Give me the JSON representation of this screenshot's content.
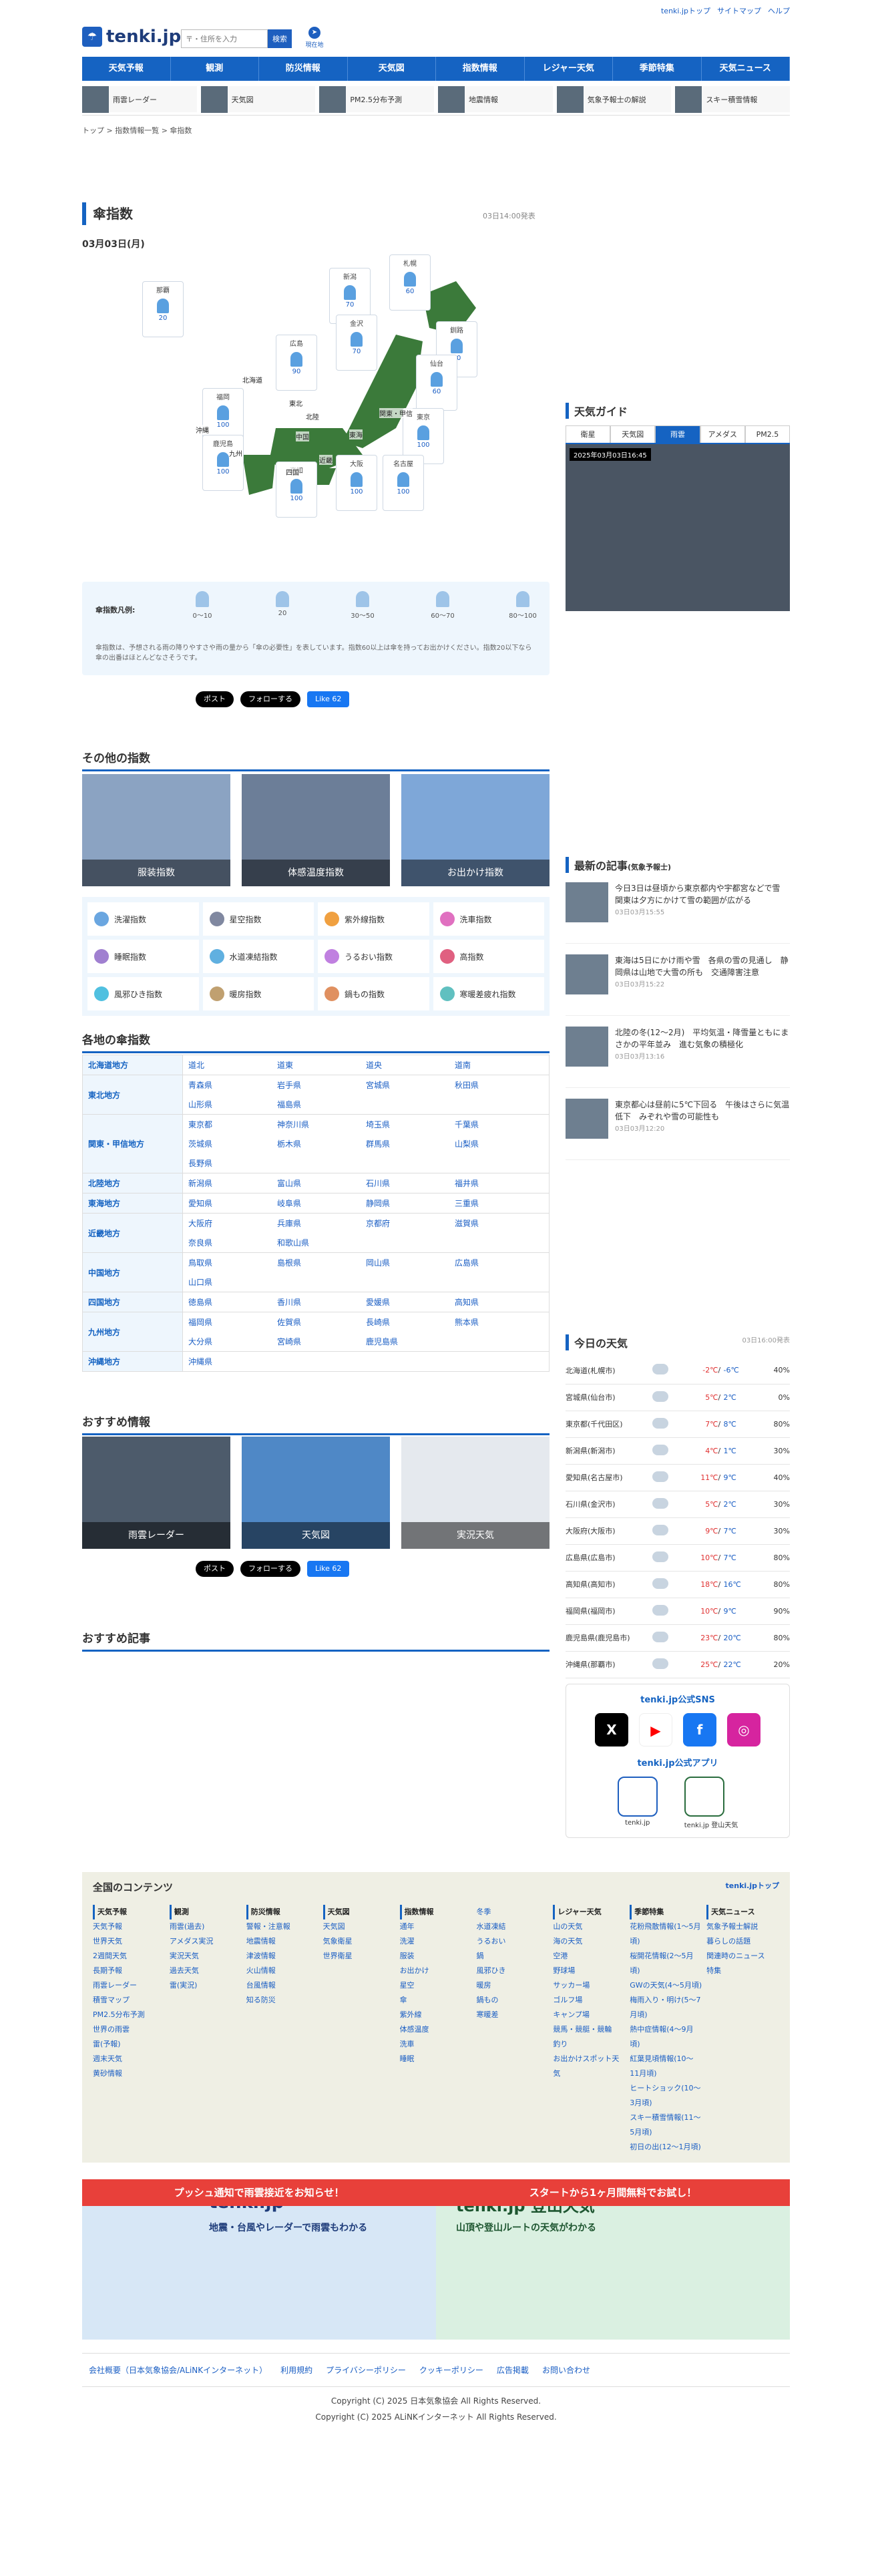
{
  "header": {
    "logo": "tenki.jp",
    "search_placeholder": "〒・住所を入力",
    "search_button": "検索",
    "geo": "現在地",
    "links": [
      "tenki.jpトップ",
      "サイトマップ",
      "ヘルプ"
    ]
  },
  "gnav": [
    "天気予報",
    "観測",
    "防災情報",
    "天気図",
    "指数情報",
    "レジャー天気",
    "季節特集",
    "天気ニュース"
  ],
  "subnav": [
    "雨雲レーダー",
    "天気図",
    "PM2.5分布予測",
    "地震情報",
    "気象予報士の解説",
    "スキー積雪情報"
  ],
  "breadcrumb": "トップ > 指数情報一覧 > 傘指数",
  "page": {
    "title": "傘指数",
    "issued": "03日14:00発表",
    "date": "03月03日(月)"
  },
  "cities": [
    {
      "name": "那覇",
      "val": "20"
    },
    {
      "name": "札幌",
      "val": "60"
    },
    {
      "name": "新潟",
      "val": "70"
    },
    {
      "name": "釧路",
      "val": "20"
    },
    {
      "name": "広島",
      "val": "90"
    },
    {
      "name": "金沢",
      "val": "70"
    },
    {
      "name": "仙台",
      "val": "60"
    },
    {
      "name": "福岡",
      "val": "100"
    },
    {
      "name": "鹿児島",
      "val": "100"
    },
    {
      "name": "東京",
      "val": "100"
    },
    {
      "name": "高知",
      "val": "100"
    },
    {
      "name": "大阪",
      "val": "100"
    },
    {
      "name": "名古屋",
      "val": "100"
    }
  ],
  "map_labels": [
    "沖縄",
    "北海道",
    "東北",
    "北陸",
    "中国",
    "近畿",
    "関東・甲信",
    "九州",
    "四国",
    "東海"
  ],
  "legend": {
    "title": "傘指数凡例:",
    "items": [
      "0〜10",
      "20",
      "30〜50",
      "60〜70",
      "80〜100"
    ],
    "note": "傘指数は、予想される雨の降りやすさや雨の量から「傘の必要性」を表しています。指数60以上は傘を持ってお出かけください。指数20以下なら傘の出番はほとんどなさそうです。"
  },
  "share": {
    "post": "ポスト",
    "follow": "フォローする",
    "like": "Like 62"
  },
  "other": {
    "title": "その他の指数",
    "tiles": [
      "服装指数",
      "体感温度指数",
      "お出かけ指数"
    ],
    "items": [
      "洗濯指数",
      "星空指数",
      "紫外線指数",
      "洗車指数",
      "睡眠指数",
      "水道凍結指数",
      "うるおい指数",
      "高指数",
      "風邪ひき指数",
      "暖房指数",
      "鍋もの指数",
      "寒暖差疲れ指数"
    ]
  },
  "regions": {
    "title": "各地の傘指数",
    "rows": [
      {
        "r": "北海道地方",
        "p": [
          "道北",
          "道東",
          "道央",
          "道南"
        ]
      },
      {
        "r": "東北地方",
        "p": [
          "青森県",
          "岩手県",
          "宮城県",
          "秋田県",
          "山形県",
          "福島県"
        ]
      },
      {
        "r": "関東・甲信地方",
        "p": [
          "東京都",
          "神奈川県",
          "埼玉県",
          "千葉県",
          "茨城県",
          "栃木県",
          "群馬県",
          "山梨県",
          "長野県"
        ]
      },
      {
        "r": "北陸地方",
        "p": [
          "新潟県",
          "富山県",
          "石川県",
          "福井県"
        ]
      },
      {
        "r": "東海地方",
        "p": [
          "愛知県",
          "岐阜県",
          "静岡県",
          "三重県"
        ]
      },
      {
        "r": "近畿地方",
        "p": [
          "大阪府",
          "兵庫県",
          "京都府",
          "滋賀県",
          "奈良県",
          "和歌山県"
        ]
      },
      {
        "r": "中国地方",
        "p": [
          "鳥取県",
          "島根県",
          "岡山県",
          "広島県",
          "山口県"
        ]
      },
      {
        "r": "四国地方",
        "p": [
          "徳島県",
          "香川県",
          "愛媛県",
          "高知県"
        ]
      },
      {
        "r": "九州地方",
        "p": [
          "福岡県",
          "佐賀県",
          "長崎県",
          "熊本県",
          "大分県",
          "宮崎県",
          "鹿児島県"
        ]
      },
      {
        "r": "沖縄地方",
        "p": [
          "沖縄県"
        ]
      }
    ]
  },
  "recommend": {
    "title": "おすすめ情報",
    "tiles": [
      "雨雲レーダー",
      "天気図",
      "実況天気"
    ]
  },
  "articles_title": "おすすめ記事",
  "guide": {
    "title": "天気ガイド",
    "tabs": [
      "衛星",
      "天気図",
      "雨雲",
      "アメダス",
      "PM2.5"
    ],
    "stamp": "2025年03月03日16:45"
  },
  "news": {
    "title": "最新の記事",
    "sub": "(気象予報士)",
    "items": [
      {
        "t": "今日3日は昼頃から東京都内や宇都宮などで雪　関東は夕方にかけて雪の範囲が広がる",
        "d": "03日03月15:55"
      },
      {
        "t": "東海は5日にかけ雨や雪　各県の雪の見通し　静岡県は山地で大雪の所も　交通障害注意",
        "d": "03日03月15:22"
      },
      {
        "t": "北陸の冬(12〜2月)　平均気温・降雪量ともにまさかの平年並み　進む気象の積極化",
        "d": "03日03月13:16"
      },
      {
        "t": "東京都心は昼前に5℃下回る　午後はさらに気温低下　みぞれや雪の可能性も",
        "d": "03日03月12:20"
      }
    ]
  },
  "today": {
    "title": "今日の天気",
    "issued": "03日16:00発表",
    "rows": [
      {
        "c": "北海道(札幌市)",
        "h": "-2℃",
        "l": "-6℃",
        "p": "40%"
      },
      {
        "c": "宮城県(仙台市)",
        "h": "5℃",
        "l": "2℃",
        "p": "0%"
      },
      {
        "c": "東京都(千代田区)",
        "h": "7℃",
        "l": "8℃",
        "p": "80%"
      },
      {
        "c": "新潟県(新潟市)",
        "h": "4℃",
        "l": "1℃",
        "p": "30%"
      },
      {
        "c": "愛知県(名古屋市)",
        "h": "11℃",
        "l": "9℃",
        "p": "40%"
      },
      {
        "c": "石川県(金沢市)",
        "h": "5℃",
        "l": "2℃",
        "p": "30%"
      },
      {
        "c": "大阪府(大阪市)",
        "h": "9℃",
        "l": "7℃",
        "p": "30%"
      },
      {
        "c": "広島県(広島市)",
        "h": "10℃",
        "l": "7℃",
        "p": "80%"
      },
      {
        "c": "高知県(高知市)",
        "h": "18℃",
        "l": "16℃",
        "p": "80%"
      },
      {
        "c": "福岡県(福岡市)",
        "h": "10℃",
        "l": "9℃",
        "p": "90%"
      },
      {
        "c": "鹿児島県(鹿児島市)",
        "h": "23℃",
        "l": "20℃",
        "p": "80%"
      },
      {
        "c": "沖縄県(那覇市)",
        "h": "25℃",
        "l": "22℃",
        "p": "20%"
      }
    ]
  },
  "sns": {
    "title": "tenki.jp公式SNS",
    "app_title": "tenki.jp公式アプリ",
    "apps": [
      "tenki.jp",
      "tenki.jp 登山天気"
    ]
  },
  "footer": {
    "title": "全国のコンテンツ",
    "top": "tenki.jpトップ",
    "cols": [
      {
        "h": "天気予報",
        "l": [
          "天気予報",
          "世界天気",
          "2週間天気",
          "長期予報",
          "雨雲レーダー",
          "積雪マップ",
          "PM2.5分布予測",
          "世界の雨雲",
          "雷(予報)",
          "週末天気",
          "黄砂情報"
        ]
      },
      {
        "h": "観測",
        "l": [
          "雨雲(過去)",
          "アメダス実況",
          "実況天気",
          "過去天気",
          "雷(実況)"
        ]
      },
      {
        "h": "防災情報",
        "l": [
          "警報・注意報",
          "地震情報",
          "津波情報",
          "火山情報",
          "台風情報",
          "知る防災"
        ]
      },
      {
        "h": "天気図",
        "l": [
          "天気図",
          "気象衛星",
          "世界衛星"
        ]
      },
      {
        "h": "指数情報",
        "l": [
          "通年",
          "洗濯",
          "服装",
          "お出かけ",
          "星空",
          "傘",
          "紫外線",
          "体感温度",
          "洗車",
          "睡眠"
        ]
      },
      {
        "h": "",
        "l": [
          "冬季",
          "水道凍結",
          "うるおい",
          "鍋",
          "風邪ひき",
          "暖房",
          "鍋もの",
          "寒暖差"
        ]
      },
      {
        "h": "レジャー天気",
        "l": [
          "山の天気",
          "海の天気",
          "空港",
          "野球場",
          "サッカー場",
          "ゴルフ場",
          "キャンプ場",
          "競馬・競艇・競輪",
          "釣り",
          "お出かけスポット天気"
        ]
      },
      {
        "h": "季節特集",
        "l": [
          "花粉飛散情報(1〜5月頃)",
          "桜開花情報(2〜5月頃)",
          "GWの天気(4〜5月頃)",
          "梅雨入り・明け(5〜7月頃)",
          "熱中症情報(4〜9月頃)",
          "紅葉見頃情報(10〜11月頃)",
          "ヒートショック(10〜3月頃)",
          "スキー積雪情報(11〜5月頃)",
          "初日の出(12〜1月頃)"
        ]
      },
      {
        "h": "天気ニュース",
        "l": [
          "気象予報士解説",
          "暮らしの話題",
          "関連時のニュース",
          "特集"
        ]
      }
    ]
  },
  "banner": {
    "left_title": "tenki.jp",
    "left_sub": "地震・台風やレーダーで雨雲もわかる",
    "left_bar": "プッシュ通知で雨雲接近をお知らせ！",
    "right_title": "tenki.jp 登山天気",
    "right_sub": "山頂や登山ルートの天気がわかる",
    "right_bar": "スタートから1ヶ月間無料でお試し！"
  },
  "flinks": [
    "会社概要（日本気象協会/ALiNKインターネット）",
    "利用規約",
    "プライバシーポリシー",
    "クッキーポリシー",
    "広告掲載",
    "お問い合わせ"
  ],
  "copyright": [
    "Copyright (C) 2025 日本気象協会 All Rights Reserved.",
    "Copyright (C) 2025 ALiNKインターネット All Rights Reserved."
  ]
}
